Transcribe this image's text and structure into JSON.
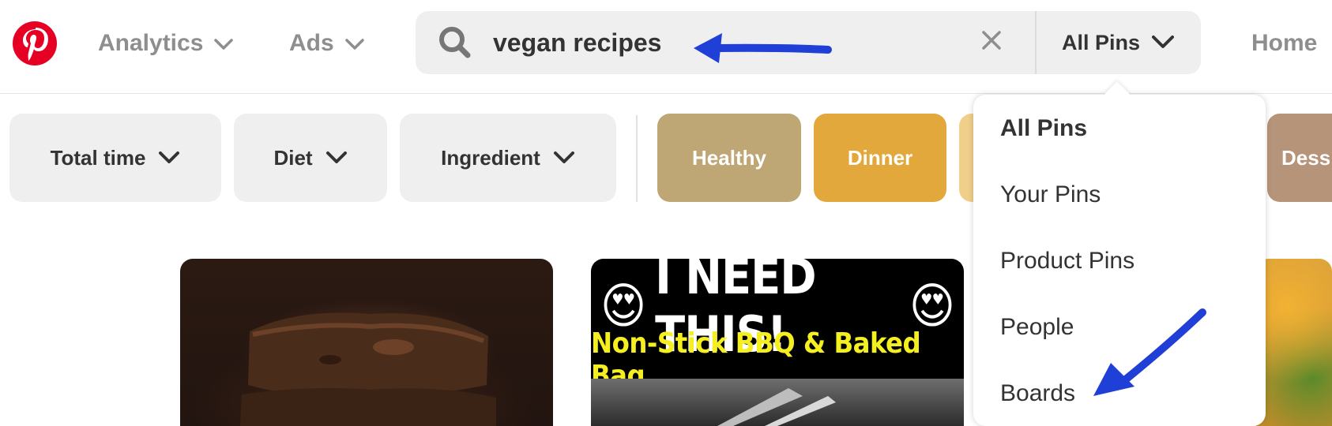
{
  "header": {
    "logo_icon": "pinterest-logo-icon",
    "nav": [
      {
        "label": "Analytics"
      },
      {
        "label": "Ads"
      }
    ],
    "home_label": "Home"
  },
  "search": {
    "query": "vegan recipes",
    "scope_label": "All Pins",
    "icons": {
      "search": "search-icon",
      "clear": "close-icon",
      "scope": "chevron-down-icon"
    }
  },
  "filters": [
    {
      "label": "Total time"
    },
    {
      "label": "Diet"
    },
    {
      "label": "Ingredient"
    }
  ],
  "chips": [
    {
      "label": "Healthy",
      "color": "#bea675"
    },
    {
      "label": "Dinner",
      "color": "#e2a83c"
    },
    {
      "label": "",
      "color": "#f0cf8a"
    },
    {
      "label": "Dess",
      "color": "#b69479"
    }
  ],
  "scope_menu": {
    "items": [
      {
        "label": "All Pins",
        "selected": true
      },
      {
        "label": "Your Pins"
      },
      {
        "label": "Product Pins"
      },
      {
        "label": "People"
      },
      {
        "label": "Boards"
      }
    ]
  },
  "pins": {
    "ad": {
      "headline": "I NEED THIS!",
      "subline": "Non-Stick BBQ & Baked Bag",
      "emoji": "😍"
    }
  },
  "colors": {
    "brand_red": "#e60023",
    "annotation_arrow": "#1f3fd6"
  }
}
